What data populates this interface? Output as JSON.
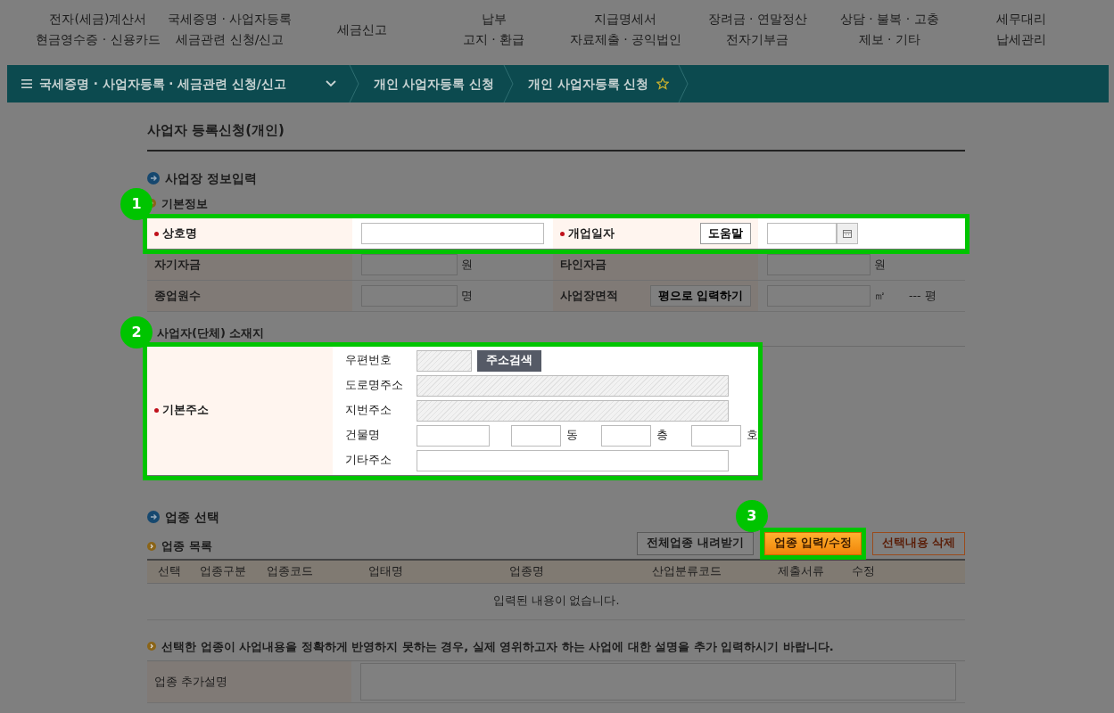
{
  "top_menu": [
    [
      "전자(세금)계산서",
      "현금영수증 · 신용카드"
    ],
    [
      "국세증명 · 사업자등록",
      "세금관련 신청/신고"
    ],
    [
      "세금신고"
    ],
    [
      "납부",
      "고지 · 환급"
    ],
    [
      "지급명세서",
      "자료제출 · 공익법인"
    ],
    [
      "장려금 · 연말정산",
      "전자기부금"
    ],
    [
      "상담 · 불복 · 고충",
      "제보 · 기타"
    ],
    [
      "세무대리",
      "납세관리"
    ]
  ],
  "breadcrumb": [
    {
      "label": "국세증명 · 사업자등록 · 세금관련 신청/신고",
      "kind": "menu"
    },
    {
      "label": "개인 사업자등록 신청",
      "kind": "plain"
    },
    {
      "label": "개인 사업자등록 신청",
      "kind": "favorite"
    }
  ],
  "page_title": "사업자 등록신청(개인)",
  "info_section": {
    "title": "사업장 정보입력",
    "basic": {
      "title": "기본정보",
      "rows": [
        {
          "callout": "1",
          "cells": [
            {
              "label": "상호명",
              "required": true,
              "kind": "text"
            },
            {
              "label": "개업일자",
              "required": true,
              "button": "도움말",
              "kind": "date"
            }
          ]
        },
        {
          "cells": [
            {
              "label": "자기자금",
              "required": false,
              "kind": "text",
              "unit": "원"
            },
            {
              "label": "타인자금",
              "required": false,
              "kind": "text",
              "unit": "원"
            }
          ]
        },
        {
          "cells": [
            {
              "label": "종업원수",
              "required": false,
              "kind": "text",
              "unit": "명"
            },
            {
              "label": "사업장면적",
              "required": false,
              "button": "평으로 입력하기",
              "kind": "text",
              "unit": "㎡",
              "extra": "--- 평"
            }
          ]
        }
      ]
    },
    "address": {
      "title": "사업자(단체) 소재지",
      "callout": "2",
      "label": "기본주소",
      "required": true,
      "fields": [
        {
          "label": "우편번호",
          "kind": "zip",
          "button": "주소검색"
        },
        {
          "label": "도로명주소",
          "kind": "readonly"
        },
        {
          "label": "지번주소",
          "kind": "readonly"
        },
        {
          "label": "건물명",
          "kind": "building",
          "units": [
            "동",
            "층",
            "호"
          ]
        },
        {
          "label": "기타주소",
          "kind": "text"
        }
      ]
    }
  },
  "industry": {
    "title": "업종 선택",
    "list_title": "업종 목록",
    "buttons": [
      {
        "label": "전체업종 내려받기",
        "kind": "plain"
      },
      {
        "label": "업종 입력/수정",
        "kind": "primary",
        "callout": "3"
      },
      {
        "label": "선택내용 삭제",
        "kind": "outline"
      }
    ],
    "columns": [
      "선택",
      "업종구분",
      "업종코드",
      "업태명",
      "업종명",
      "산업분류코드",
      "제출서류",
      "수정"
    ],
    "empty_message": "입력된 내용이 없습니다.",
    "note": "선택한 업종이 사업내용을 정확하게 반영하지 못하는 경우, 실제 영위하고자 하는 사업에 대한 설명을 추가 입력하시기 바랍니다.",
    "extra_label": "업종 추가설명"
  }
}
